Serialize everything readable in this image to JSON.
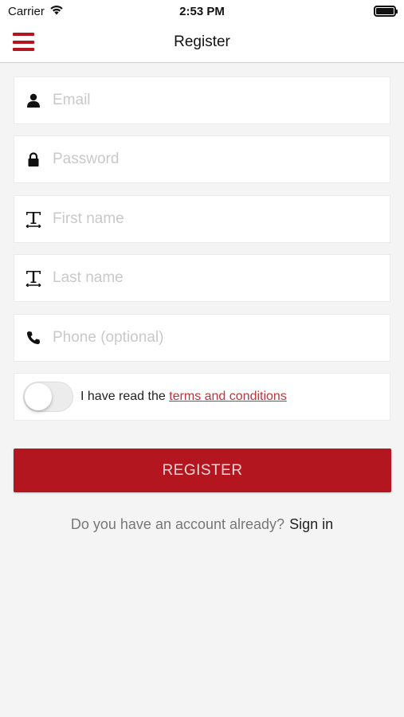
{
  "status_bar": {
    "carrier": "Carrier",
    "time": "2:53 PM",
    "wifi_icon": "wifi-icon",
    "battery_icon": "battery-icon"
  },
  "nav": {
    "title": "Register",
    "menu_icon": "hamburger-menu-icon",
    "accent_color": "#b3161f"
  },
  "form": {
    "email": {
      "placeholder": "Email",
      "value": "",
      "icon": "user-icon"
    },
    "password": {
      "placeholder": "Password",
      "value": "",
      "icon": "lock-icon"
    },
    "first_name": {
      "placeholder": "First name",
      "value": "",
      "icon": "text-icon"
    },
    "last_name": {
      "placeholder": "Last name",
      "value": "",
      "icon": "text-icon"
    },
    "phone": {
      "placeholder": "Phone (optional)",
      "value": "",
      "icon": "phone-icon"
    },
    "terms": {
      "prefix": "I have read the ",
      "link_text": "terms and conditions",
      "accepted": false
    },
    "register_label": "REGISTER"
  },
  "signin": {
    "prompt": "Do you have an account already?",
    "link_text": "Sign in"
  }
}
